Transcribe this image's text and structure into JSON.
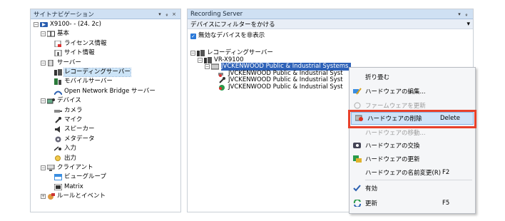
{
  "left_pane": {
    "title": "サイトナビゲーション",
    "controls": [
      "▾",
      "ᵩ",
      "×"
    ],
    "tree": [
      {
        "label": "X9100-        - (24. 2c)",
        "level": 0,
        "icon": "server-icon",
        "expander": "−"
      },
      {
        "label": "基本",
        "level": 1,
        "icon": "book-icon",
        "expander": "−"
      },
      {
        "label": "ライセンス情報",
        "level": 2,
        "icon": "license-icon"
      },
      {
        "label": "サイト情報",
        "level": 2,
        "icon": "site-info-icon"
      },
      {
        "label": "サーバー",
        "level": 1,
        "icon": "server-group-icon",
        "expander": "−"
      },
      {
        "label": "レコーディングサーバー",
        "level": 2,
        "icon": "recording-server-icon",
        "selected": true
      },
      {
        "label": "モバイルサーバー",
        "level": 2,
        "icon": "mobile-server-icon"
      },
      {
        "label": "Open Network Bridge サーバー",
        "level": 2,
        "icon": "bridge-icon"
      },
      {
        "label": "デバイス",
        "level": 1,
        "icon": "device-icon",
        "expander": "−"
      },
      {
        "label": "カメラ",
        "level": 2,
        "icon": "camera-icon"
      },
      {
        "label": "マイク",
        "level": 2,
        "icon": "microphone-icon"
      },
      {
        "label": "スピーカー",
        "level": 2,
        "icon": "speaker-icon"
      },
      {
        "label": "メタデータ",
        "level": 2,
        "icon": "metadata-icon"
      },
      {
        "label": "入力",
        "level": 2,
        "icon": "input-icon"
      },
      {
        "label": "出力",
        "level": 2,
        "icon": "output-icon"
      },
      {
        "label": "クライアント",
        "level": 1,
        "icon": "client-icon",
        "expander": "−"
      },
      {
        "label": "ビューグループ",
        "level": 2,
        "icon": "view-group-icon"
      },
      {
        "label": "Matrix",
        "level": 2,
        "icon": "matrix-icon"
      },
      {
        "label": "ルールとイベント",
        "level": 1,
        "icon": "rules-icon",
        "expander": "+"
      }
    ]
  },
  "right_pane": {
    "title": "Recording Server",
    "controls": [
      "▾",
      "ᵩ"
    ],
    "filter_label": "デバイスにフィルターをかける",
    "filter_chevron": "▾",
    "hide_disabled_label": "無効なデバイスを非表示",
    "hide_disabled_checked": true,
    "tree": [
      {
        "label": "レコーディングサーバー",
        "level": 0,
        "expander": "−"
      },
      {
        "label": "VR-X9100",
        "level": 1,
        "expander": "−"
      },
      {
        "label": "JVCKENWOOD Public & Industrial Systems",
        "level": 2,
        "expander": "−",
        "selected": true
      },
      {
        "label": "JVCKENWOOD Public & Industrial Syst",
        "level": 3
      },
      {
        "label": "JVCKENWOOD Public & Industrial Syst",
        "level": 3
      },
      {
        "label": "JVCKENWOOD Public & Industrial Syst",
        "level": 3
      }
    ]
  },
  "context_menu": {
    "items": [
      {
        "label": "折り畳む",
        "shortcut": "",
        "icon": ""
      },
      {
        "label": "ハードウェアの編集...",
        "shortcut": "",
        "icon": "edit-hardware-icon"
      },
      {
        "label": "ファームウェアを更新",
        "shortcut": "",
        "icon": "firmware-icon",
        "dim": true
      },
      {
        "label": "ハードウェアの削除",
        "shortcut": "Delete",
        "icon": "delete-hardware-icon",
        "highlight": true
      },
      {
        "label": "ハードウェアの移動...",
        "shortcut": "",
        "icon": "",
        "dim": true
      },
      {
        "label": "ハードウェアの交換",
        "shortcut": "",
        "icon": "replace-hardware-icon"
      },
      {
        "label": "ハードウェアの更新",
        "shortcut": "",
        "icon": "update-hardware-icon"
      },
      {
        "label": "ハードウェアの名前変更(R)",
        "shortcut": "F2",
        "icon": ""
      },
      {
        "label": "有効",
        "shortcut": "",
        "icon": "check-icon"
      },
      {
        "label": "更新",
        "shortcut": "F5",
        "icon": "refresh-icon"
      }
    ]
  },
  "colors": {
    "highlight_box": "#e8412b",
    "selection": "#2e62b8",
    "titlebar": "#cfe0f3"
  }
}
